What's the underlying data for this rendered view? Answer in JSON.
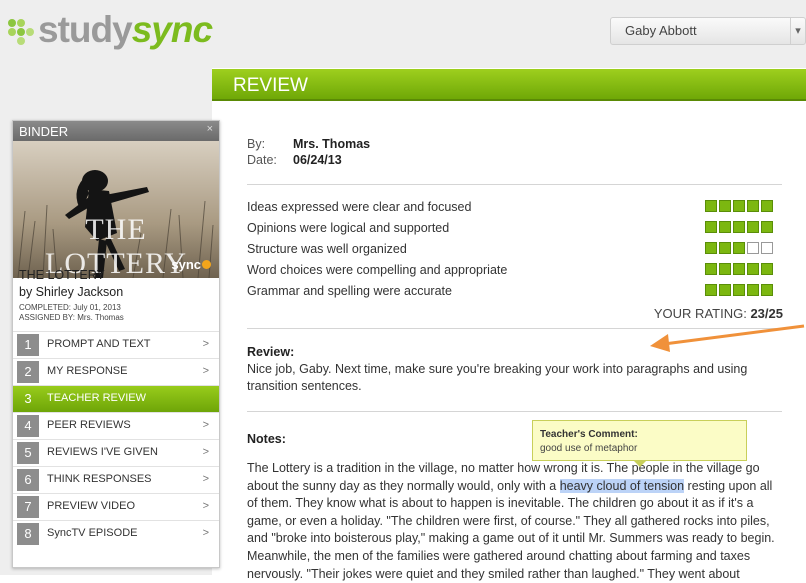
{
  "app": {
    "logo_text_1": "study",
    "logo_text_2": "sync"
  },
  "user": {
    "name": "Gaby Abbott"
  },
  "review": {
    "header": "REVIEW",
    "by_label": "By:",
    "by_value": "Mrs. Thomas",
    "date_label": "Date:",
    "date_value": "06/24/13",
    "criteria": [
      {
        "label": "Ideas expressed were clear and focused",
        "score": 5
      },
      {
        "label": "Opinions were logical and supported",
        "score": 5
      },
      {
        "label": "Structure was well organized",
        "score": 3
      },
      {
        "label": "Word choices were compelling and appropriate",
        "score": 5
      },
      {
        "label": "Grammar and spelling were accurate",
        "score": 5
      }
    ],
    "max_score": 5,
    "rating_label": "YOUR RATING:",
    "rating_value": "23/25",
    "review_label": "Review:",
    "review_text": "Nice job, Gaby. Next time, make sure you're breaking your work into paragraphs and using transition sentences.",
    "notes_label": "Notes:",
    "tooltip_head": "Teacher's Comment:",
    "tooltip_body": "good use of metaphor",
    "notes_before": "The Lottery is a tradition in the village, no matter how wrong it is. The people in the village go about the sunny day as they normally would, only with a ",
    "notes_highlight": "heavy cloud of tension",
    "notes_after": " resting upon all of them. They know what is about to happen is inevitable. The children go about it as if it's a game, or even a holiday. \"The children were first, of course.\" They all gathered rocks into piles, and \"broke into boisterous play,\" making a game out of it until Mr. Summers was ready to begin. Meanwhile, the men of the families were gathered around chatting about farming and taxes nervously. \"Their jokes were quiet and they smiled rather than laughed.\" They went about"
  },
  "binder": {
    "title": "BINDER",
    "close": "×",
    "cover_title": "THE LOTTERY",
    "cover_brand": "sync",
    "book_title": "THE LOTTERY",
    "book_author": "by Shirley Jackson",
    "completed_label": "COMPLETED:",
    "completed_value": "July 01, 2013",
    "assigned_label": "ASSIGNED BY:",
    "assigned_value": "Mrs. Thomas",
    "items": [
      {
        "num": "1",
        "label": "PROMPT AND TEXT",
        "chev": ">"
      },
      {
        "num": "2",
        "label": "MY RESPONSE",
        "chev": ">"
      },
      {
        "num": "3",
        "label": "TEACHER REVIEW",
        "chev": ""
      },
      {
        "num": "4",
        "label": "PEER REVIEWS",
        "chev": ">"
      },
      {
        "num": "5",
        "label": "REVIEWS I'VE GIVEN",
        "chev": ">"
      },
      {
        "num": "6",
        "label": "THINK RESPONSES",
        "chev": ">"
      },
      {
        "num": "7",
        "label": "PREVIEW VIDEO",
        "chev": ">"
      },
      {
        "num": "8",
        "label": "SyncTV EPISODE",
        "chev": ">"
      }
    ],
    "active_index": 2
  },
  "colors": {
    "accent": "#7cb710",
    "arrow": "#f0913a",
    "highlight": "#bcd3f7"
  }
}
